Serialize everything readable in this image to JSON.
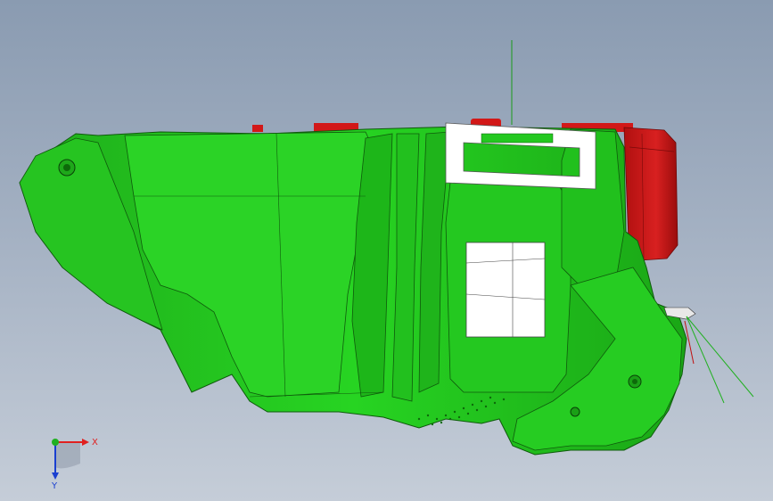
{
  "viewport": {
    "background_top": "#8a9bb1",
    "background_bottom": "#c5cdd8",
    "part_color": "#22c81e",
    "part_edge_color": "#0f5a0c",
    "red_part_color": "#d21818"
  },
  "triad": {
    "x_label": "X",
    "y_label": "Y",
    "x_color": "#e02020",
    "y_color": "#1a3fd0",
    "z_color": "#20b020"
  }
}
